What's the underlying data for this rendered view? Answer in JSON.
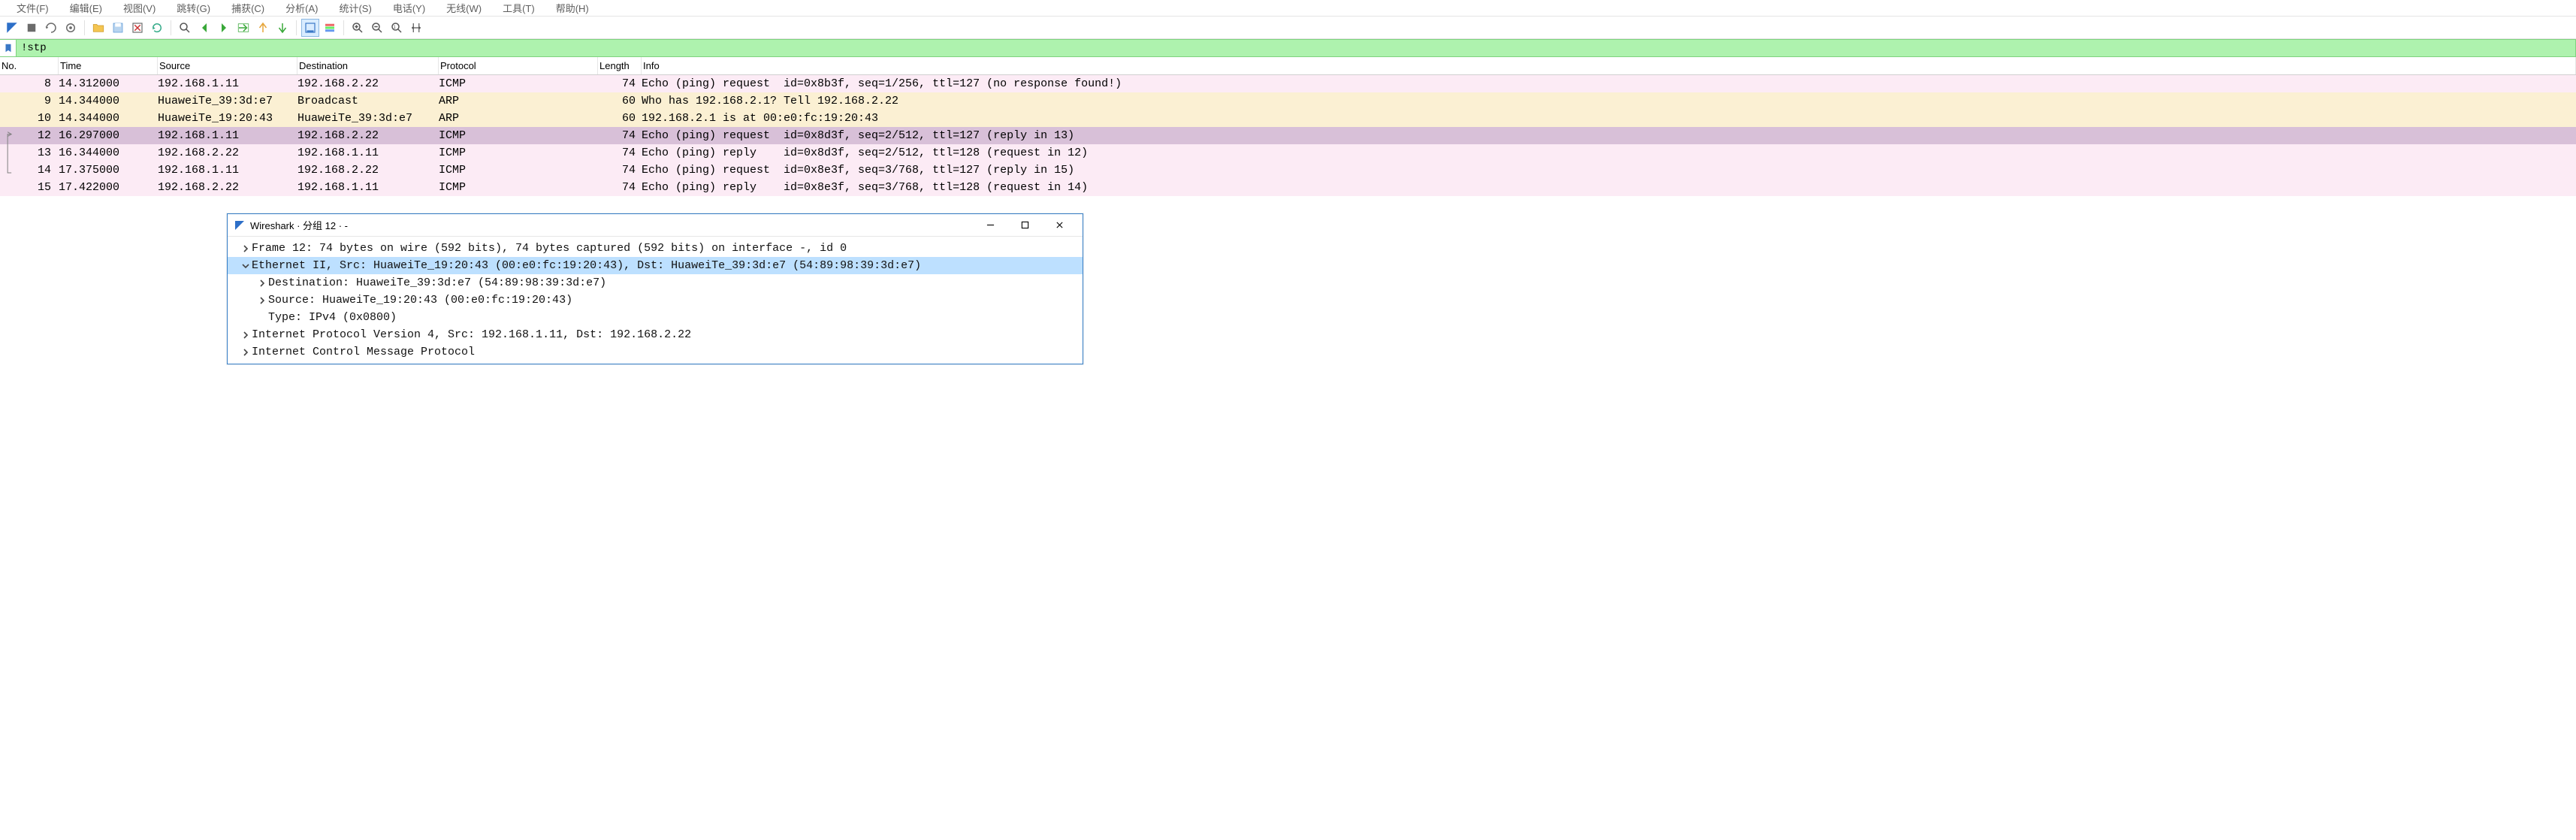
{
  "menu": {
    "file": "文件(F)",
    "edit": "编辑(E)",
    "view": "视图(V)",
    "go": "跳转(G)",
    "capture": "捕获(C)",
    "analyze": "分析(A)",
    "statistics": "统计(S)",
    "telephony": "电话(Y)",
    "wireless": "无线(W)",
    "tools": "工具(T)",
    "help": "帮助(H)"
  },
  "filter": {
    "value": "!stp"
  },
  "columns": {
    "no": "No.",
    "time": "Time",
    "source": "Source",
    "destination": "Destination",
    "protocol": "Protocol",
    "length": "Length",
    "info": "Info"
  },
  "packets": [
    {
      "cls": "pink",
      "no": "8",
      "time": "14.312000",
      "src": "192.168.1.11",
      "dst": "192.168.2.22",
      "proto": "ICMP",
      "len": "74",
      "info": "Echo (ping) request  id=0x8b3f, seq=1/256, ttl=127 (no response found!)"
    },
    {
      "cls": "yellow",
      "no": "9",
      "time": "14.344000",
      "src": "HuaweiTe_39:3d:e7",
      "dst": "Broadcast",
      "proto": "ARP",
      "len": "60",
      "info": "Who has 192.168.2.1? Tell 192.168.2.22"
    },
    {
      "cls": "yellow",
      "no": "10",
      "time": "14.344000",
      "src": "HuaweiTe_19:20:43",
      "dst": "HuaweiTe_39:3d:e7",
      "proto": "ARP",
      "len": "60",
      "info": "192.168.2.1 is at 00:e0:fc:19:20:43"
    },
    {
      "cls": "sel",
      "no": "12",
      "time": "16.297000",
      "src": "192.168.1.11",
      "dst": "192.168.2.22",
      "proto": "ICMP",
      "len": "74",
      "info": "Echo (ping) request  id=0x8d3f, seq=2/512, ttl=127 (reply in 13)"
    },
    {
      "cls": "pink",
      "no": "13",
      "time": "16.344000",
      "src": "192.168.2.22",
      "dst": "192.168.1.11",
      "proto": "ICMP",
      "len": "74",
      "info": "Echo (ping) reply    id=0x8d3f, seq=2/512, ttl=128 (request in 12)"
    },
    {
      "cls": "pink",
      "no": "14",
      "time": "17.375000",
      "src": "192.168.1.11",
      "dst": "192.168.2.22",
      "proto": "ICMP",
      "len": "74",
      "info": "Echo (ping) request  id=0x8e3f, seq=3/768, ttl=127 (reply in 15)"
    },
    {
      "cls": "pink",
      "no": "15",
      "time": "17.422000",
      "src": "192.168.2.22",
      "dst": "192.168.1.11",
      "proto": "ICMP",
      "len": "74",
      "info": "Echo (ping) reply    id=0x8e3f, seq=3/768, ttl=128 (request in 14)"
    }
  ],
  "details_window": {
    "title": "Wireshark · 分组 12 · -",
    "lines": [
      {
        "indent": 0,
        "expander": "closed",
        "selected": false,
        "text": "Frame 12: 74 bytes on wire (592 bits), 74 bytes captured (592 bits) on interface -, id 0"
      },
      {
        "indent": 0,
        "expander": "open",
        "selected": true,
        "text": "Ethernet II, Src: HuaweiTe_19:20:43 (00:e0:fc:19:20:43), Dst: HuaweiTe_39:3d:e7 (54:89:98:39:3d:e7)"
      },
      {
        "indent": 1,
        "expander": "closed",
        "selected": false,
        "text": "Destination: HuaweiTe_39:3d:e7 (54:89:98:39:3d:e7)"
      },
      {
        "indent": 1,
        "expander": "closed",
        "selected": false,
        "text": "Source: HuaweiTe_19:20:43 (00:e0:fc:19:20:43)"
      },
      {
        "indent": 1,
        "expander": "none",
        "selected": false,
        "text": "Type: IPv4 (0x0800)"
      },
      {
        "indent": 0,
        "expander": "closed",
        "selected": false,
        "text": "Internet Protocol Version 4, Src: 192.168.1.11, Dst: 192.168.2.22"
      },
      {
        "indent": 0,
        "expander": "closed",
        "selected": false,
        "text": "Internet Control Message Protocol"
      }
    ]
  }
}
